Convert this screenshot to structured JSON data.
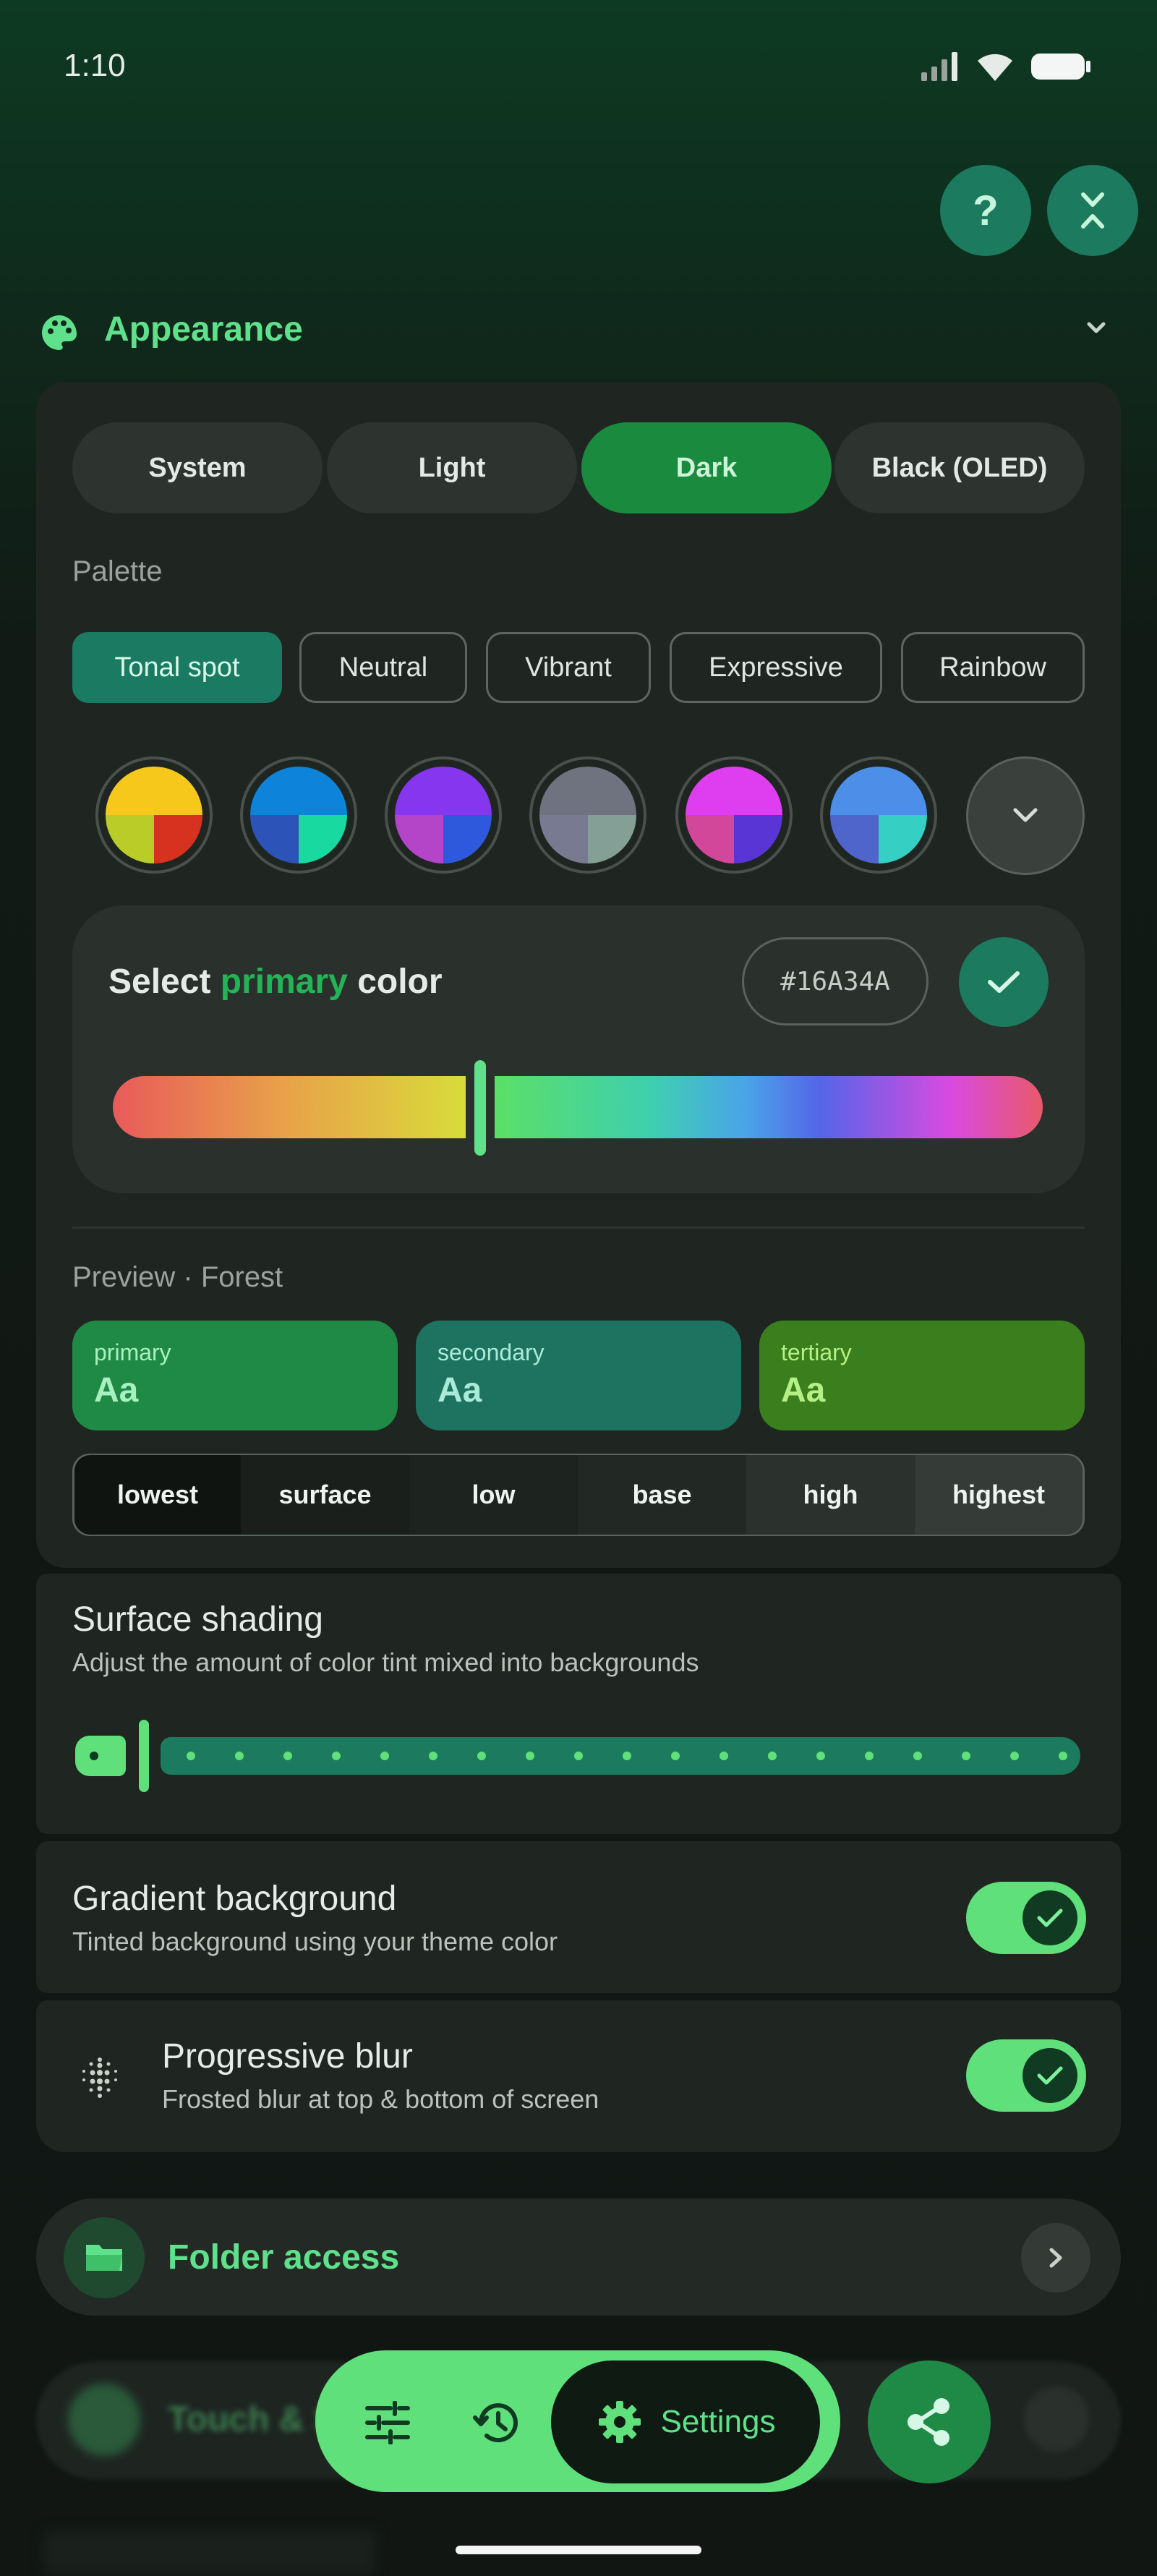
{
  "status": {
    "time": "1:10"
  },
  "appearance": {
    "title": "Appearance",
    "theme_modes": [
      "System",
      "Light",
      "Dark",
      "Black (OLED)"
    ],
    "selected_mode": "Dark",
    "palette_label": "Palette",
    "palettes": [
      "Tonal spot",
      "Neutral",
      "Vibrant",
      "Expressive",
      "Rainbow"
    ],
    "selected_palette": "Tonal spot",
    "select_color": {
      "prefix": "Select ",
      "accent": "primary",
      "suffix": " color",
      "hex_value": "#16A34A"
    },
    "preview_label": "Preview · Forest",
    "preview": [
      {
        "label": "primary",
        "sample": "Aa",
        "bg": "#1f8a45",
        "fg": "#a8f0bf"
      },
      {
        "label": "secondary",
        "sample": "Aa",
        "bg": "#1e7360",
        "fg": "#a9ead9"
      },
      {
        "label": "tertiary",
        "sample": "Aa",
        "bg": "#3a7e1d",
        "fg": "#b6f085"
      }
    ],
    "surfaces": [
      "lowest",
      "surface",
      "low",
      "base",
      "high",
      "highest"
    ]
  },
  "surface_shading": {
    "title": "Surface shading",
    "subtitle": "Adjust the amount of color tint mixed into backgrounds",
    "level": 0.0
  },
  "gradient_background": {
    "title": "Gradient background",
    "subtitle": "Tinted background using your theme color",
    "enabled": true
  },
  "progressive_blur": {
    "title": "Progressive blur",
    "subtitle": "Frosted blur at top & bottom of screen",
    "enabled": true
  },
  "folder_access": {
    "title": "Folder access"
  },
  "touch_row": {
    "title": "Touch & S"
  },
  "bottom_nav": {
    "settings_label": "Settings"
  },
  "colors": {
    "accent_green": "#5fe08a",
    "primary_selected": "#16A34A",
    "teal": "#1c7a5e"
  }
}
